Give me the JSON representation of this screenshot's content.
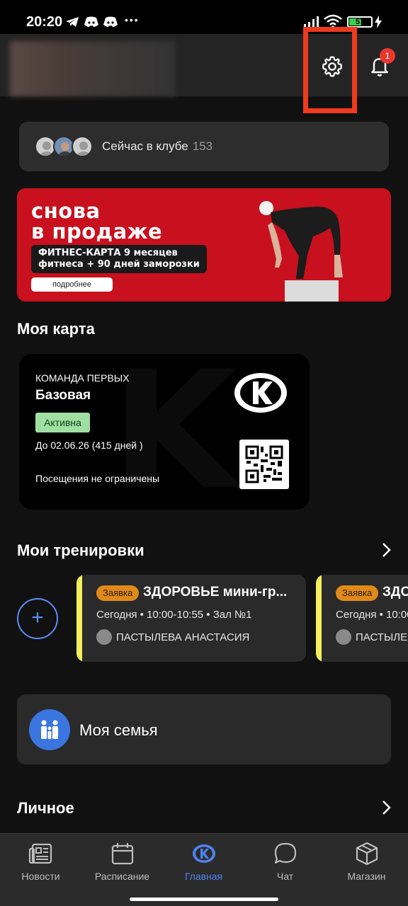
{
  "status_bar": {
    "time": "20:20",
    "battery": "57",
    "battery_level": 0.57,
    "icons": [
      "telegram-icon",
      "discord-icon",
      "discord-icon",
      "more-icon",
      "signal-icon",
      "wifi-icon",
      "battery-icon",
      "charging-icon"
    ],
    "more_glyph": "•••"
  },
  "header": {
    "settings_icon": "gear-icon",
    "notifications_icon": "bell-icon",
    "notifications_count": "1",
    "highlight_color": "#ee3a1e"
  },
  "club_now": {
    "label": "Сейчас в клубе",
    "count": "153"
  },
  "banner": {
    "title_line1": "снова",
    "title_line2": "в продаже",
    "subtitle_line1": "ФИТНЕС-КАРТА 9 месяцев",
    "subtitle_line2": "фитнеса + 90 дней заморозки",
    "button": "подробнее",
    "color": "#c8101e"
  },
  "my_card": {
    "section_title": "Моя карта",
    "club": "КОМАНДА ПЕРВЫХ",
    "plan": "Базовая",
    "status": "Активна",
    "valid_until": "До 02.06.26 (415 дней )",
    "visits": "Посещения не ограничены",
    "status_color": "#9fe0a2"
  },
  "trainings": {
    "section_title": "Мои тренировки",
    "items": [
      {
        "tag": "Заявка",
        "title": "ЗДОРОВЬЕ мини-гр...",
        "time": "Сегодня • 10:00-10:55 • Зал №1",
        "trainer": "ПАСТЫЛЕВА АНАСТАСИЯ"
      },
      {
        "tag": "Заявка",
        "title": "ЗДО",
        "time": "Сегодня • 10:00",
        "trainer": "ПАСТЫЛЕВ"
      }
    ],
    "accent_color": "#f4ed5c"
  },
  "family": {
    "label": "Моя семья",
    "icon": "family-icon"
  },
  "personal": {
    "section_title": "Личное"
  },
  "bottom_nav": {
    "items": [
      {
        "label": "Новости",
        "icon": "news-icon"
      },
      {
        "label": "Расписание",
        "icon": "calendar-icon"
      },
      {
        "label": "Главная",
        "icon": "home-logo-icon"
      },
      {
        "label": "Чат",
        "icon": "chat-icon"
      },
      {
        "label": "Магазин",
        "icon": "shop-icon"
      }
    ],
    "active_index": 2,
    "active_color": "#4f82ef"
  }
}
